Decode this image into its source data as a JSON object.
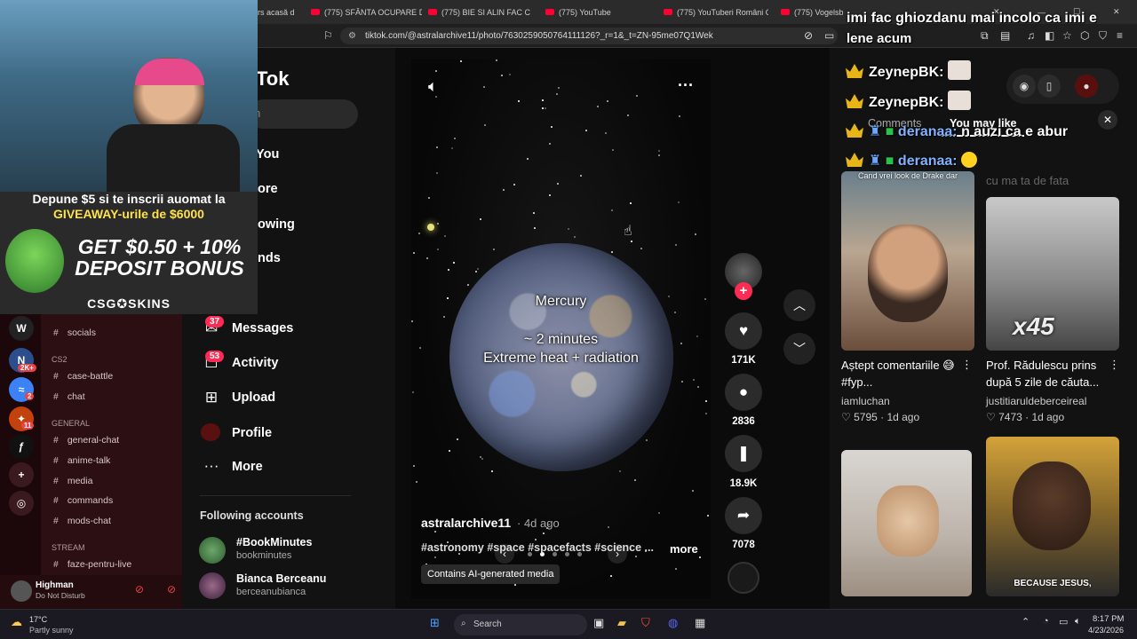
{
  "browser": {
    "tabs": [
      {
        "label": "rs acasă d"
      },
      {
        "label": "(775) SFÂNTA OCUPARE DE"
      },
      {
        "label": "(775) BIE SI ALIN FAC CELE !"
      },
      {
        "label": "(775) YouTube"
      },
      {
        "label": "(775) YouTuberi Români Can"
      },
      {
        "label": "(775) Vogelsbrunn Tourism"
      }
    ],
    "url": "tiktok.com/@astralarchive11/photo/7630259050764111126?_r=1&_t=ZN-95me07Q1Wek"
  },
  "stream_overlay": {
    "promo_headline_1": "Depune $5 si te inscrii auomat la",
    "promo_headline_2": "GIVEAWAY-urile de $6000",
    "promo_big_1": "GET $0.50 + 10%",
    "promo_big_2": "DEPOSIT BONUS",
    "promo_brand": "CSG✪SKINS"
  },
  "chat_overlay": {
    "top_message_1": "imi fac ghiozdanu mai incolo ca imi e",
    "top_message_2": "lene acum",
    "lines": [
      {
        "user": "ZeynepBK:",
        "text": ""
      },
      {
        "user": "ZeynepBK:",
        "text": ""
      },
      {
        "user": "deranaa:",
        "text": "n auzi ca e abur"
      },
      {
        "user": "deranaa:",
        "text": ""
      }
    ]
  },
  "tiktok": {
    "logo_partial": "Tok",
    "search_partial": "h",
    "nav": {
      "foryou": "You",
      "explore": "ore",
      "following": "owing",
      "friends": "nds",
      "messages": "Messages",
      "messages_badge": "37",
      "activity": "Activity",
      "activity_badge": "53",
      "upload": "Upload",
      "profile": "Profile",
      "more": "More"
    },
    "following_header": "Following accounts",
    "accounts": [
      {
        "name": "#BookMinutes",
        "handle": "bookminutes"
      },
      {
        "name": "Bianca Berceanu",
        "handle": "berceanubianca"
      }
    ],
    "video": {
      "title": "Mercury",
      "line2": "~ 2 minutes",
      "line3": "Extreme heat + radiation",
      "author": "astralarchive11",
      "date": "· 4d ago",
      "hashtags": "#astronomy #space #spacefacts #science ...",
      "more": "more",
      "ai_label": "Contains AI-generated media",
      "slide_index": 2,
      "slide_count": 5
    },
    "actions": {
      "likes": "171K",
      "comments": "2836",
      "saves": "18.9K",
      "shares": "7078"
    },
    "right_panel": {
      "tab_comments": "Comments",
      "tab_you_may_like": "You may like",
      "faded_text": "cu ma ta de fata",
      "cards": [
        {
          "overlay": "Cand vrei look de Drake dar",
          "title": "Aștept comentariile 😅 #fyp...",
          "author": "iamluchan",
          "stats": "♡ 5795 · 1d ago"
        },
        {
          "overlay": "x45",
          "title": "Prof. Rădulescu prins după 5 zile de căuta...",
          "author": "justitiaruldeberceireal",
          "stats": "♡ 7473 · 1d ago"
        },
        {
          "overlay": "",
          "title": "",
          "author": "",
          "stats": ""
        },
        {
          "overlay": "BECAUSE JESUS,",
          "title": "",
          "author": "",
          "stats": ""
        }
      ]
    }
  },
  "discord": {
    "categories": [
      "CS2",
      "GENERAL",
      "STREAM"
    ],
    "channels": [
      {
        "name": "socials"
      },
      {
        "name": "case-battle"
      },
      {
        "name": "chat"
      },
      {
        "name": "general-chat"
      },
      {
        "name": "anime-talk"
      },
      {
        "name": "media"
      },
      {
        "name": "commands"
      },
      {
        "name": "mods-chat"
      },
      {
        "name": "faze-pentru-live"
      }
    ],
    "server_badges": [
      "2K+",
      "2",
      "11"
    ],
    "user": {
      "name": "Highman",
      "status": "Do Not Disturb"
    }
  },
  "taskbar": {
    "weather_temp": "17°C",
    "weather_desc": "Partly sunny",
    "search": "Search",
    "time": "8:17 PM",
    "date": "4/23/2026"
  },
  "colors": {
    "tiktok_red": "#fe2c55",
    "crown": "#e8b518",
    "discord_bg": "#2b0f12"
  }
}
